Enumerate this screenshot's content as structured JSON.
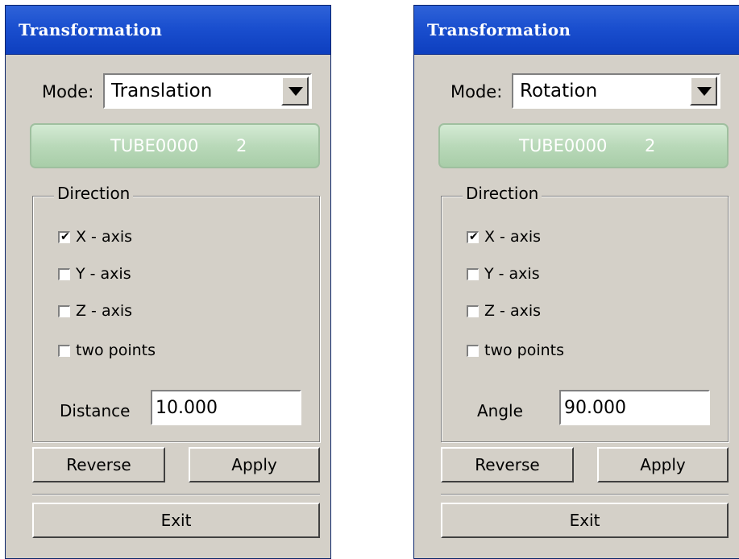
{
  "panels": [
    {
      "title": "Transformation",
      "mode_label": "Mode:",
      "mode_value": "Translation",
      "entity_name": "TUBE0000",
      "entity_count": "2",
      "direction_label": "Direction",
      "options": [
        {
          "label": "X - axis",
          "checked": true
        },
        {
          "label": "Y - axis",
          "checked": false
        },
        {
          "label": "Z - axis",
          "checked": false
        },
        {
          "label": "two points",
          "checked": false
        }
      ],
      "field_label": "Distance",
      "field_value": "10.000",
      "reverse_label": "Reverse",
      "apply_label": "Apply",
      "exit_label": "Exit"
    },
    {
      "title": "Transformation",
      "mode_label": "Mode:",
      "mode_value": "Rotation",
      "entity_name": "TUBE0000",
      "entity_count": "2",
      "direction_label": "Direction",
      "options": [
        {
          "label": "X - axis",
          "checked": true
        },
        {
          "label": "Y - axis",
          "checked": false
        },
        {
          "label": "Z - axis",
          "checked": false
        },
        {
          "label": "two points",
          "checked": false
        }
      ],
      "field_label": "Angle",
      "field_value": "90.000",
      "reverse_label": "Reverse",
      "apply_label": "Apply",
      "exit_label": "Exit"
    }
  ],
  "icons": {
    "dropdown": "chevron-down-icon",
    "check": "check-icon"
  }
}
